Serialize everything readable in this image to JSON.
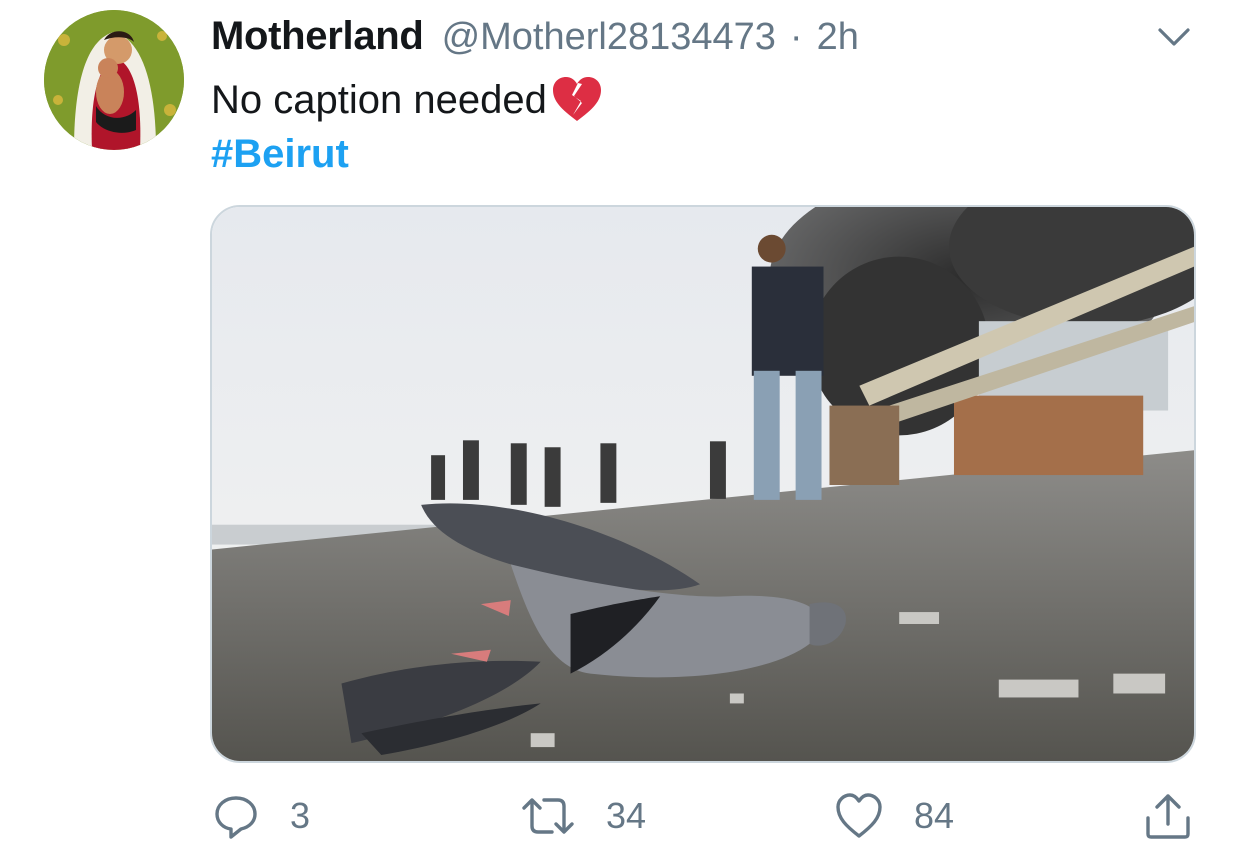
{
  "tweet": {
    "display_name": "Motherland",
    "handle": "@Motherl28134473",
    "separator": "·",
    "time": "2h",
    "text": "No caption needed",
    "emoji": "broken-heart",
    "hashtag": "#Beirut"
  },
  "actions": {
    "reply_count": "3",
    "retweet_count": "34",
    "like_count": "84"
  },
  "icons": {
    "caret": "chevron-down-icon",
    "reply": "reply-icon",
    "retweet": "retweet-icon",
    "like": "heart-icon",
    "share": "share-icon"
  },
  "colors": {
    "link": "#1da1f2",
    "secondary_text": "#657786",
    "primary_text": "#14171a",
    "emoji_red": "#dd2e44"
  }
}
